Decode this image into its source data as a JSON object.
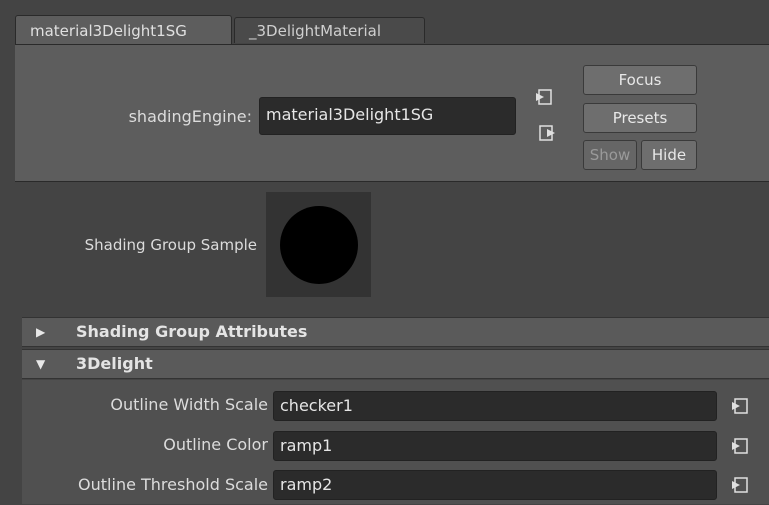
{
  "tabs": [
    {
      "label": "material3Delight1SG",
      "active": true
    },
    {
      "label": "_3DelightMaterial",
      "active": false
    }
  ],
  "shading_engine": {
    "label": "shadingEngine:",
    "value": "material3Delight1SG"
  },
  "buttons": {
    "focus": "Focus",
    "presets": "Presets",
    "show": "Show",
    "hide": "Hide"
  },
  "sample": {
    "label": "Shading Group Sample"
  },
  "frames": [
    {
      "title": "Shading Group Attributes",
      "expanded": false
    },
    {
      "title": "3Delight",
      "expanded": true
    }
  ],
  "attributes": [
    {
      "label": "Outline Width Scale",
      "value": "checker1"
    },
    {
      "label": "Outline Color",
      "value": "ramp1"
    },
    {
      "label": "Outline Threshold Scale",
      "value": "ramp2"
    }
  ],
  "colors": {
    "background": "#444444",
    "panel": "#5d5d5d",
    "field": "#2b2b2b",
    "button": "#6e6e6e"
  }
}
